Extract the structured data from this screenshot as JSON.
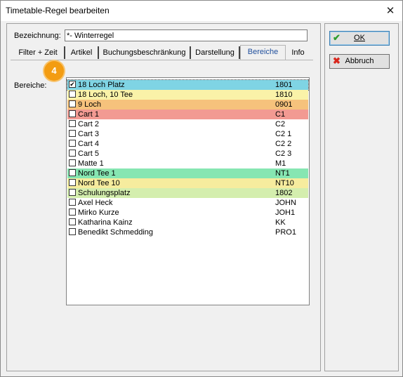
{
  "window": {
    "title": "Timetable-Regel bearbeiten",
    "close_glyph": "✕"
  },
  "form": {
    "bezeichnung_label": "Bezeichnung:",
    "bezeichnung_value": "*- Winterregel",
    "bereiche_label": "Bereiche:"
  },
  "tabs": [
    {
      "label": "Filter + Zeit"
    },
    {
      "label": "Artikel"
    },
    {
      "label": "Buchungsbeschränkung"
    },
    {
      "label": "Darstellung"
    },
    {
      "label": "Bereiche",
      "active": true
    },
    {
      "label": "Info"
    }
  ],
  "step_badge": "4",
  "areas": [
    {
      "name": "18 Loch Platz",
      "code": "1801",
      "checked": true,
      "color": "#7fd4e4"
    },
    {
      "name": "18 Loch, 10 Tee",
      "code": "1810",
      "checked": false,
      "color": "#faf2a8"
    },
    {
      "name": "9 Loch",
      "code": "0901",
      "checked": false,
      "color": "#f6c27c"
    },
    {
      "name": "Cart 1",
      "code": "C1",
      "checked": false,
      "color": "#f29a92"
    },
    {
      "name": "Cart 2",
      "code": "C2",
      "checked": false,
      "color": ""
    },
    {
      "name": "Cart 3",
      "code": "C2 1",
      "checked": false,
      "color": ""
    },
    {
      "name": "Cart 4",
      "code": "C2 2",
      "checked": false,
      "color": ""
    },
    {
      "name": "Cart 5",
      "code": "C2 3",
      "checked": false,
      "color": ""
    },
    {
      "name": "Matte 1",
      "code": "M1",
      "checked": false,
      "color": ""
    },
    {
      "name": "Nord Tee 1",
      "code": "NT1",
      "checked": false,
      "color": "#86e6b2"
    },
    {
      "name": "Nord Tee 10",
      "code": "NT10",
      "checked": false,
      "color": "#f6ec9e"
    },
    {
      "name": "Schulungsplatz",
      "code": "1802",
      "checked": false,
      "color": "#d4eeae"
    },
    {
      "name": "Axel Heck",
      "code": "JOHN",
      "checked": false,
      "color": ""
    },
    {
      "name": "Mirko Kurze",
      "code": "JOH1",
      "checked": false,
      "color": ""
    },
    {
      "name": "Katharina Kainz",
      "code": "KK",
      "checked": false,
      "color": ""
    },
    {
      "name": "Benedikt Schmedding",
      "code": "PRO1",
      "checked": false,
      "color": ""
    }
  ],
  "buttons": {
    "ok": {
      "label": "OK",
      "icon": "check-icon",
      "glyph": "✔",
      "color": "#2e9e2e"
    },
    "cancel": {
      "label": "Abbruch",
      "icon": "cross-icon",
      "glyph": "✖",
      "color": "#d9261c"
    }
  }
}
